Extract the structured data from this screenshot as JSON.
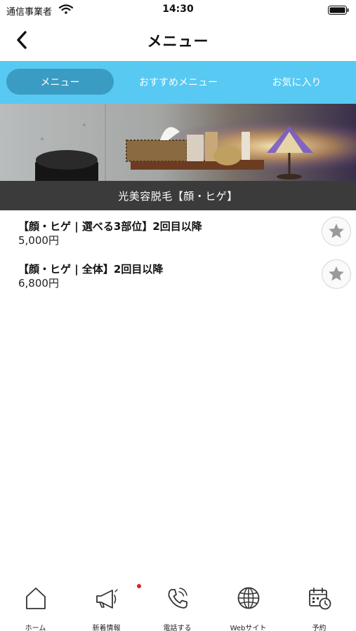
{
  "status_bar": {
    "carrier": "通信事業者",
    "time": "14:30"
  },
  "nav": {
    "title": "メニュー",
    "back_icon": "chevron-left-icon"
  },
  "tabs": [
    {
      "label": "メニュー",
      "active": true
    },
    {
      "label": "おすすめメニュー",
      "active": false
    },
    {
      "label": "お気に入り",
      "active": false
    }
  ],
  "banner": {
    "caption": "光美容脱毛【顔・ヒゲ】"
  },
  "menu_items": [
    {
      "name": "【顔・ヒゲ | 選べる3部位】2回目以降",
      "price": "5,000円",
      "favorite_icon": "star-icon",
      "favorited": false
    },
    {
      "name": "【顔・ヒゲ | 全体】2回目以降",
      "price": "6,800円",
      "favorite_icon": "star-icon",
      "favorited": false
    }
  ],
  "tab_bar": [
    {
      "label": "ホーム",
      "icon": "home-icon"
    },
    {
      "label": "新着情報",
      "icon": "megaphone-icon",
      "badge": true
    },
    {
      "label": "電話する",
      "icon": "phone-icon"
    },
    {
      "label": "Webサイト",
      "icon": "globe-icon"
    },
    {
      "label": "予約",
      "icon": "calendar-clock-icon"
    }
  ],
  "colors": {
    "tab_background": "#58c9f2",
    "tab_active": "#3b9cc3",
    "banner_caption_bg": "#3b3b3b",
    "badge": "#e02020",
    "star": "#9a9a9a"
  }
}
